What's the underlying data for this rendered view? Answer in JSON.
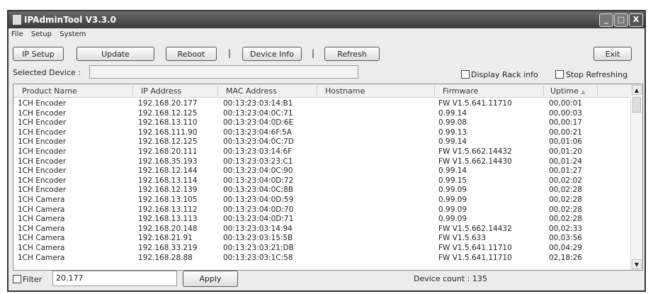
{
  "window": {
    "title": "IPAdminTool V3.3.0",
    "min": "_",
    "max": "□",
    "close": "X"
  },
  "menu": [
    "File",
    "Setup",
    "System"
  ],
  "toolbar": {
    "ip_setup": "IP Setup",
    "update": "Update",
    "reboot": "Reboot",
    "device_info": "Device Info",
    "refresh": "Refresh",
    "exit": "Exit",
    "sep": "|"
  },
  "selected_device": {
    "label": "Selected Device :",
    "value": ""
  },
  "options": {
    "display_rack": "Display Rack info",
    "stop_refreshing": "Stop Refreshing"
  },
  "table": {
    "columns": [
      "Product Name",
      "IP Address",
      "MAC Address",
      "Hostname",
      "Firmware",
      "Uptime"
    ],
    "sort_indicator": "▲",
    "rows": [
      [
        "1CH Encoder",
        "192.168.20.177",
        "00:13:23:03:14:B1",
        "",
        "FW V1.5.641.11710",
        "00,00:01"
      ],
      [
        "1CH Encoder",
        "192.168.12.125",
        "00:13:23:04:0C:71",
        "",
        "0.99.14",
        "00,00:03"
      ],
      [
        "1CH Encoder",
        "192.168.13.110",
        "00:13:23:04:0D:6E",
        "",
        "0.99.08",
        "00,00:17"
      ],
      [
        "1CH Encoder",
        "192.168.111.90",
        "00:13:23:04:6F:5A",
        "",
        "0.99.13",
        "00,00:21"
      ],
      [
        "1CH Encoder",
        "192.168.12.125",
        "00:13:23:04:0C:7D",
        "",
        "0.99.14",
        "00,01:06"
      ],
      [
        "1CH Encoder",
        "192.168.20.111",
        "00:13:23:03:14:6F",
        "",
        "FW V1.5.662.14432",
        "00,01:20"
      ],
      [
        "1CH Encoder",
        "192.168.35.193",
        "00:13:23:03:23:C1",
        "",
        "FW V1.5.662.14430",
        "00,01:24"
      ],
      [
        "1CH Encoder",
        "192.168.12.144",
        "00:13:23:04:0C:90",
        "",
        "0.99.14",
        "00,01:27"
      ],
      [
        "1CH Encoder",
        "192.168.13.114",
        "00:13:23:04:0D:72",
        "",
        "0.99.15",
        "00,02:02"
      ],
      [
        "1CH Encoder",
        "192.168.12.139",
        "00:13:23:04:0C:8B",
        "",
        "0.99.09",
        "00,02:28"
      ],
      [
        "1CH Camera",
        "192.168.13.105",
        "00:13:23:04:0D:59",
        "",
        "0.99.09",
        "00,02:28"
      ],
      [
        "1CH Camera",
        "192.168.13.112",
        "00:13:23:04:0D:70",
        "",
        "0.99.09",
        "00,02:28"
      ],
      [
        "1CH Camera",
        "192.168.13.113",
        "00:13:23:04:0D:71",
        "",
        "0.99.09",
        "00,02:28"
      ],
      [
        "1CH Camera",
        "192.168.20.148",
        "00:13:23:03:14:94",
        "",
        "FW V1.5.662.14432",
        "00,02:33"
      ],
      [
        "1CH Camera",
        "192.168.21.91",
        "00:13:23:03:15:5B",
        "",
        "FW V1.5.633",
        "00,03:56"
      ],
      [
        "1CH Camera",
        "192.168.33.219",
        "00:13:23:03:21:DB",
        "",
        "FW V1.5.641.11710",
        "00,04:29"
      ],
      [
        "1CH Camera",
        "192.168.28.88",
        "00:13:23:03:1C:58",
        "",
        "FW V1.5.641.11710",
        "02,18:26"
      ]
    ]
  },
  "footer": {
    "filter_label": "Filter",
    "filter_value": "20.177",
    "apply": "Apply",
    "device_count": "Device count : 135"
  }
}
